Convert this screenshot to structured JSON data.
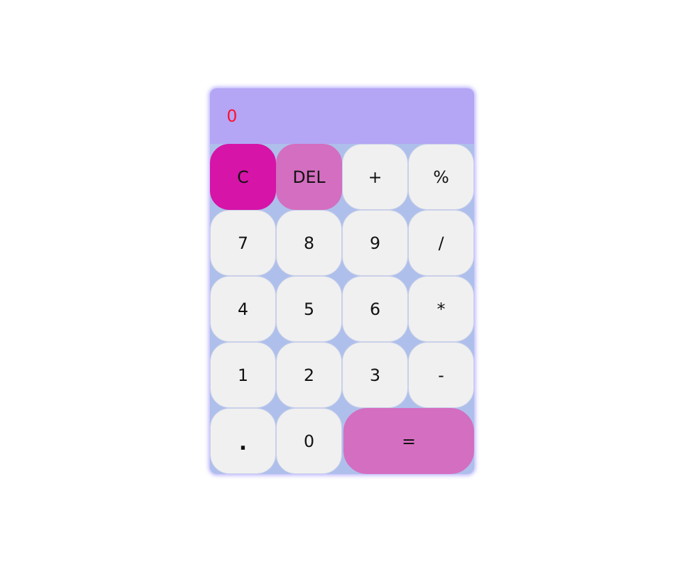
{
  "display": {
    "value": "0",
    "text_color": "#ff1030",
    "background": "#b4a6f4"
  },
  "colors": {
    "keypad_background": "#aebfeb",
    "key_default": "#f0f0f0",
    "key_clear": "#d614a8",
    "key_accent": "#d46ec0"
  },
  "keys": {
    "clear": "C",
    "del": "DEL",
    "plus": "+",
    "percent": "%",
    "seven": "7",
    "eight": "8",
    "nine": "9",
    "divide": "/",
    "four": "4",
    "five": "5",
    "six": "6",
    "multiply": "*",
    "one": "1",
    "two": "2",
    "three": "3",
    "minus": "-",
    "dot": ".",
    "zero": "0",
    "equals": "="
  }
}
